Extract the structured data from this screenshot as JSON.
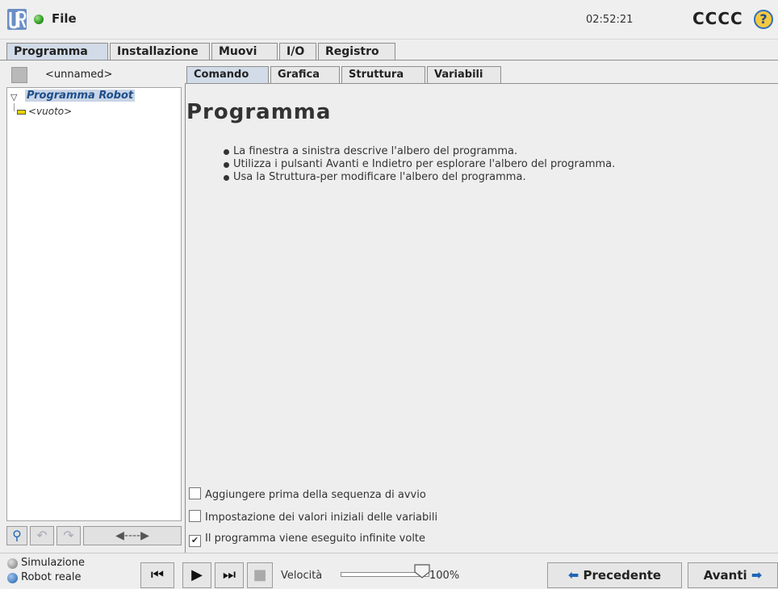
{
  "header": {
    "file_label": "File",
    "clock": "02:52:21",
    "robot_name": "CCCC",
    "help_glyph": "?"
  },
  "main_tabs": [
    "Programma",
    "Installazione",
    "Muovi",
    "I/O",
    "Registro"
  ],
  "program": {
    "name": "<unnamed>",
    "tree_root": "Programma Robot",
    "tree_child": "<vuoto>"
  },
  "sub_tabs": [
    "Comando",
    "Grafica",
    "Struttura",
    "Variabili"
  ],
  "content": {
    "title": "Programma",
    "bullets": [
      "La finestra a sinistra descrive l'albero del programma.",
      "Utilizza i pulsanti Avanti e Indietro per esplorare l'albero del programma.",
      "Usa la Struttura-per modificare l'albero del programma."
    ],
    "options": [
      {
        "label": "Aggiungere prima della sequenza di avvio",
        "checked": false
      },
      {
        "label": "Impostazione dei valori iniziali delle variabili",
        "checked": false
      },
      {
        "label": "Il programma viene eseguito infinite volte",
        "checked": true
      }
    ]
  },
  "bottom": {
    "mode_sim": "Simulazione",
    "mode_real": "Robot reale",
    "speed_label": "Velocità",
    "speed_value": "100%",
    "speed_fraction": 1.0,
    "prev_label": "Precedente",
    "next_label": "Avanti"
  },
  "colors": {
    "accent_blue": "#1f66b5",
    "selection_bg": "#c9d4e6",
    "status_green": "#2d9a22"
  }
}
